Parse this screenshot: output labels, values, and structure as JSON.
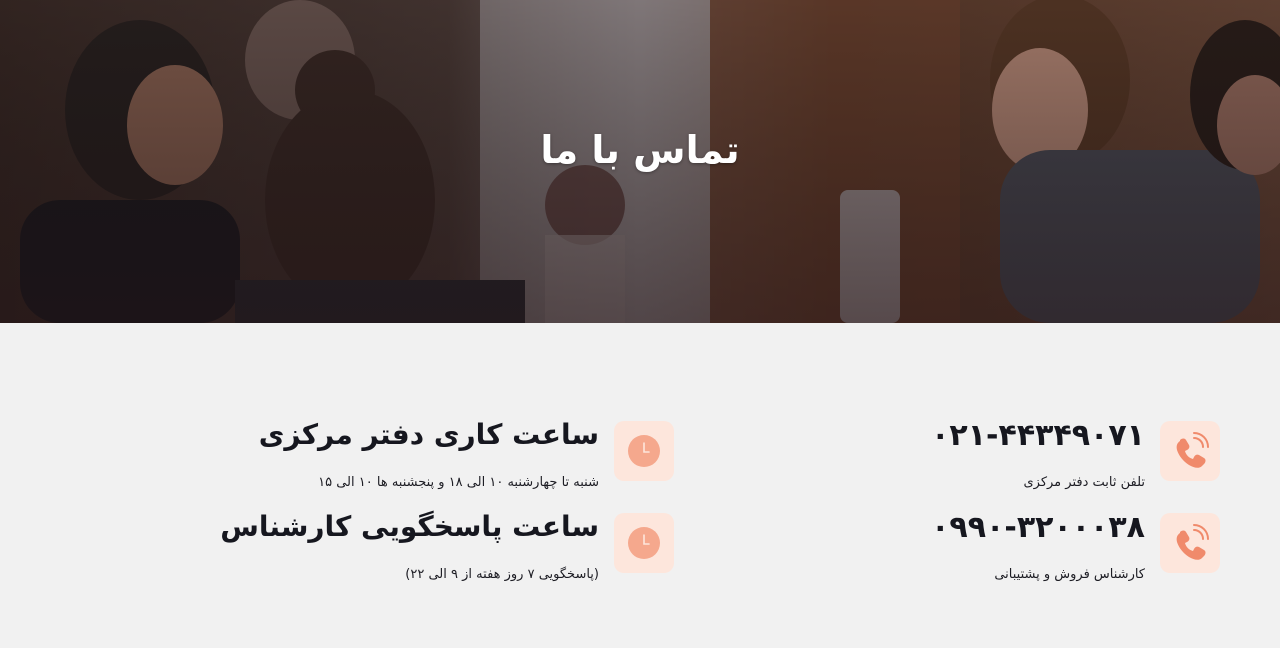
{
  "hero": {
    "title": "تماس با ما"
  },
  "contacts": [
    {
      "icon": "phone-icon",
      "value": "۰۲۱-۴۴۳۴۹۰۷۱",
      "label": "تلفن ثابت دفتر مرکزی"
    },
    {
      "icon": "phone-icon",
      "value": "۰۹۹۰-۳۲۰۰۰۳۸",
      "label": "کارشناس فروش و پشتیبانی"
    }
  ],
  "hours": [
    {
      "icon": "clock-icon",
      "title": "ساعت کاری دفتر مرکزی",
      "desc": "شنبه تا چهارشنبه ۱۰ الی ۱۸ و پنجشنبه ها ۱۰ الی ۱۵"
    },
    {
      "icon": "clock-icon",
      "title": "ساعت پاسخگویی کارشناس",
      "desc": "(پاسخگویی ۷ روز هفته از ۹ الی ۲۲)"
    }
  ],
  "colors": {
    "accent": "#f08a6b",
    "icon_bg": "#fde6dc",
    "page_bg": "#f1f1f1",
    "text": "#16171f"
  }
}
